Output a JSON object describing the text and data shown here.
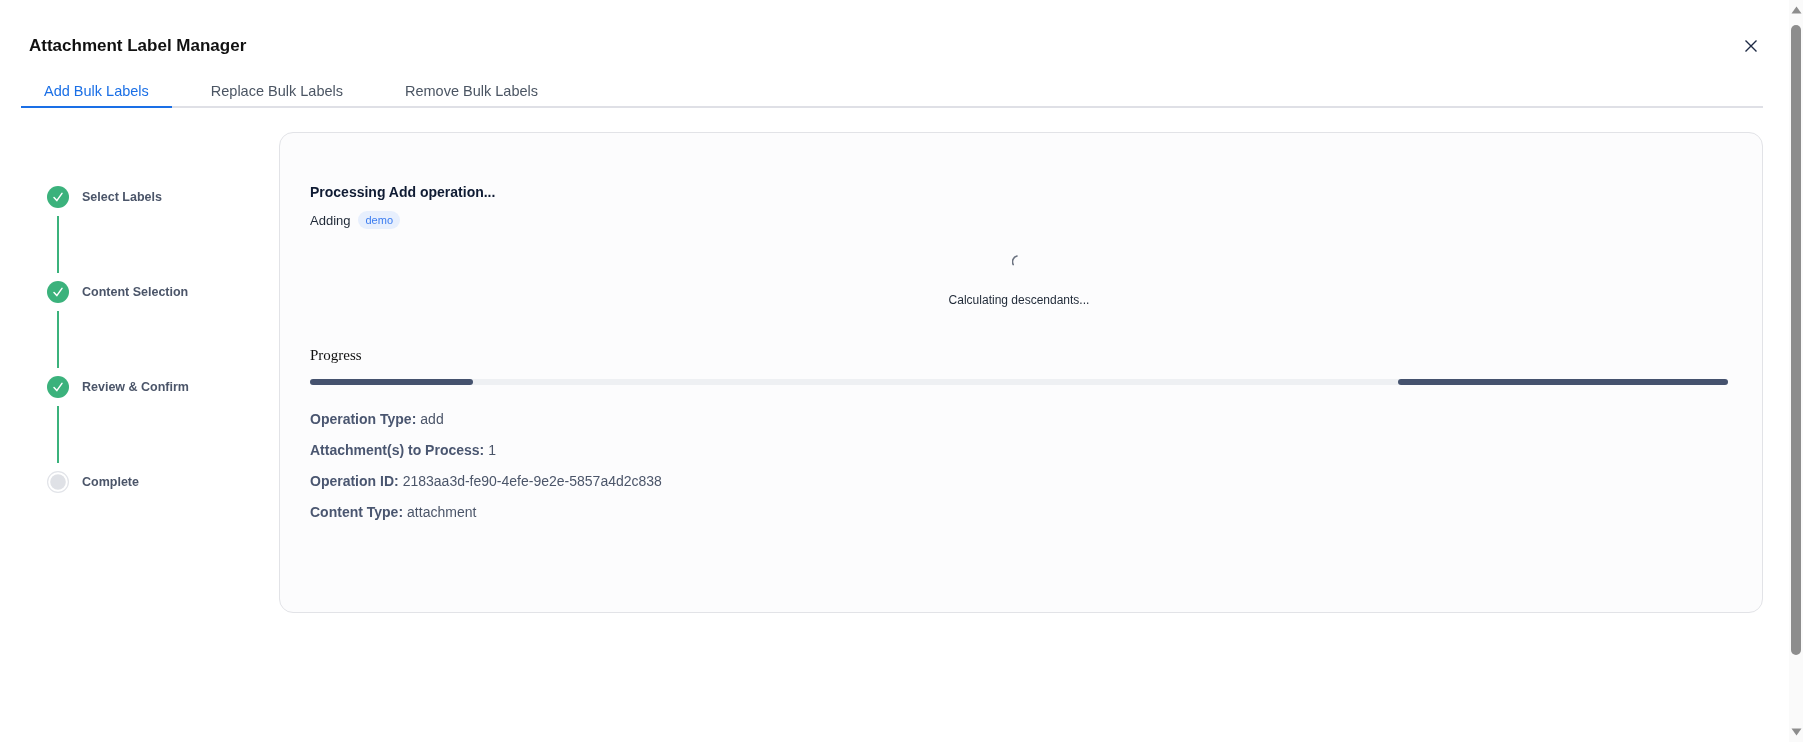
{
  "window": {
    "title": "Attachment Label Manager"
  },
  "tabs": [
    {
      "label": "Add Bulk Labels",
      "selected": true
    },
    {
      "label": "Replace Bulk Labels",
      "selected": false
    },
    {
      "label": "Remove Bulk Labels",
      "selected": false
    }
  ],
  "steps": [
    {
      "label": "Select Labels",
      "completed": true
    },
    {
      "label": "Content Selection",
      "completed": true
    },
    {
      "label": "Review & Confirm",
      "completed": true
    },
    {
      "label": "Complete",
      "completed": false
    }
  ],
  "operation": {
    "heading": "Processing Add operation...",
    "action": "Adding",
    "labels": [
      "demo"
    ],
    "status": "Calculating descendants...",
    "progress": {
      "label": "Progress",
      "indeterminate": true
    },
    "details": [
      {
        "label": "Operation Type:",
        "value": "add"
      },
      {
        "label": "Attachment(s) to Process:",
        "value": "1"
      },
      {
        "label": "Operation ID:",
        "value": "2183aa3d-fe90-4efe-9e2e-5857a4d2c838"
      },
      {
        "label": "Content Type:",
        "value": "attachment"
      }
    ]
  }
}
